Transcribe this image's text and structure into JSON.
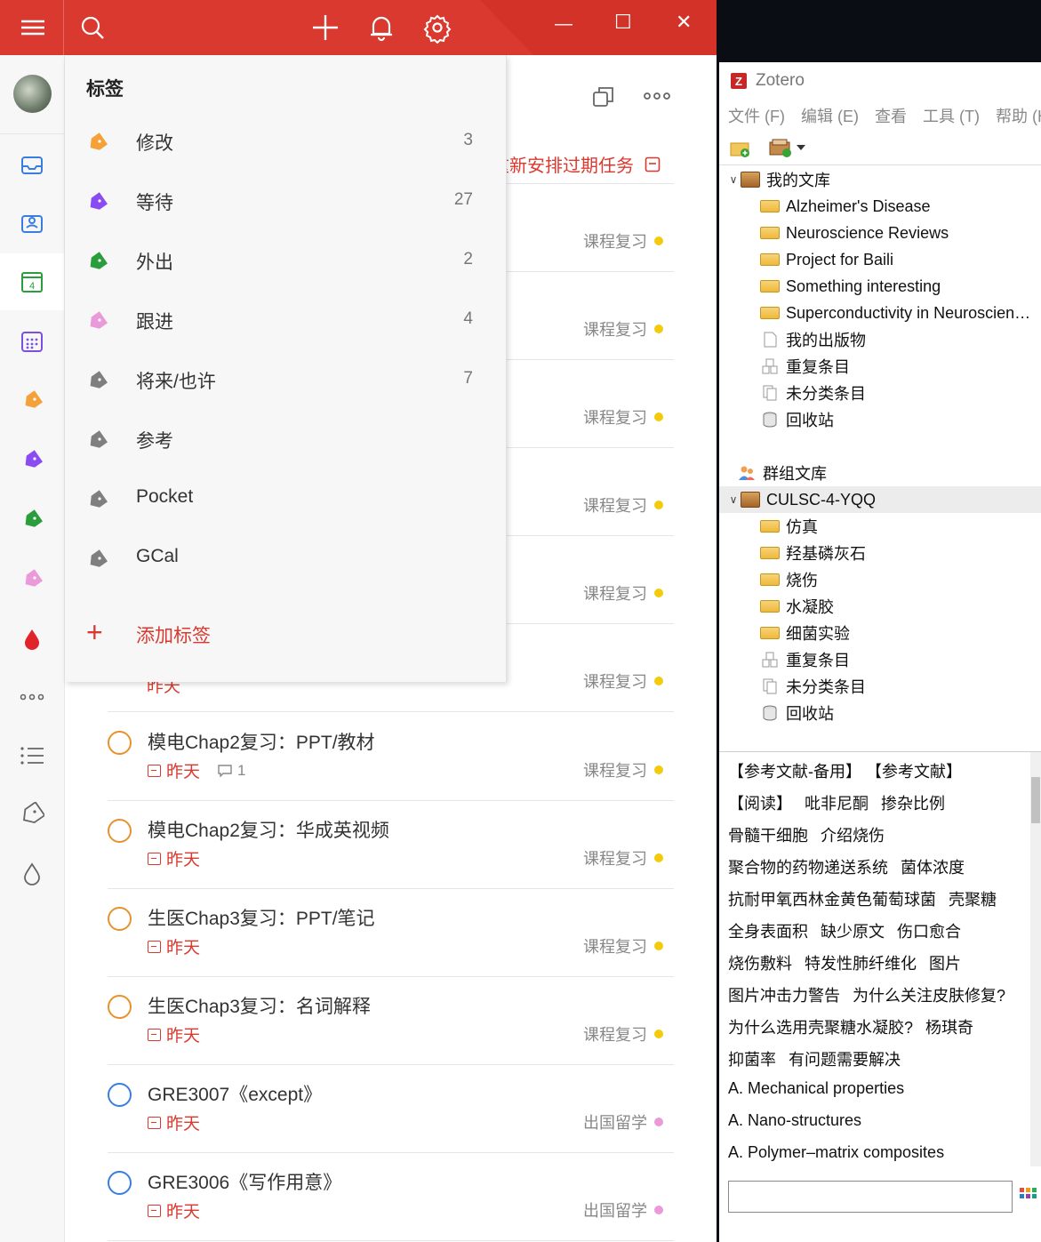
{
  "dida": {
    "window_controls": {
      "minimize": "—",
      "maximize": "☐",
      "close": "✕"
    },
    "toolbar": {
      "reschedule_label": "重新安排过期任务"
    },
    "tags_menu": {
      "header": "标签",
      "items": [
        {
          "name": "修改",
          "count": "3",
          "color": "#f5a13a"
        },
        {
          "name": "等待",
          "count": "27",
          "color": "#8a4cf2"
        },
        {
          "name": "外出",
          "count": "2",
          "color": "#2a9d3c"
        },
        {
          "name": "跟进",
          "count": "4",
          "color": "#ea9ad9"
        },
        {
          "name": "将来/也许",
          "count": "7",
          "color": "#7f7f7f"
        },
        {
          "name": "参考",
          "count": "",
          "color": "#7f7f7f"
        },
        {
          "name": "Pocket",
          "count": "",
          "color": "#7f7f7f"
        },
        {
          "name": "GCal",
          "count": "",
          "color": "#7f7f7f"
        }
      ],
      "add_label": "添加标签"
    },
    "hidden_lists": [
      "课程复习",
      "课程复习",
      "课程复习",
      "课程复习",
      "课程复习",
      "课程复习"
    ],
    "partial_date": "昨天",
    "tasks": [
      {
        "title": "模电Chap2复习：PPT/教材",
        "date": "昨天",
        "comment": "1",
        "list": "课程复习",
        "list_color": "#f2cc0c",
        "circle": "orange"
      },
      {
        "title": "模电Chap2复习：华成英视频",
        "date": "昨天",
        "comment": "",
        "list": "课程复习",
        "list_color": "#f2cc0c",
        "circle": "orange"
      },
      {
        "title": "生医Chap3复习：PPT/笔记",
        "date": "昨天",
        "comment": "",
        "list": "课程复习",
        "list_color": "#f2cc0c",
        "circle": "orange"
      },
      {
        "title": "生医Chap3复习：名词解释",
        "date": "昨天",
        "comment": "",
        "list": "课程复习",
        "list_color": "#f2cc0c",
        "circle": "orange"
      },
      {
        "title": "GRE3007《except》",
        "date": "昨天",
        "comment": "",
        "list": "出国留学",
        "list_color": "#ea9ad9",
        "circle": "blue"
      },
      {
        "title": "GRE3006《写作用意》",
        "date": "昨天",
        "comment": "",
        "list": "出国留学",
        "list_color": "#ea9ad9",
        "circle": "blue"
      }
    ],
    "accent": "#d9392f"
  },
  "zotero": {
    "title": "Zotero",
    "menu": [
      "文件 (F)",
      "编辑 (E)",
      "查看",
      "工具 (T)",
      "帮助 (H"
    ],
    "my_library": {
      "label": "我的文库",
      "items": [
        {
          "label": "Alzheimer's Disease",
          "icon": "folder"
        },
        {
          "label": "Neuroscience Reviews",
          "icon": "folder"
        },
        {
          "label": "Project for Baili",
          "icon": "folder"
        },
        {
          "label": "Something interesting",
          "icon": "folder"
        },
        {
          "label": "Superconductivity in Neuroscien…",
          "icon": "folder"
        },
        {
          "label": "我的出版物",
          "icon": "doc"
        },
        {
          "label": "重复条目",
          "icon": "dup"
        },
        {
          "label": "未分类条目",
          "icon": "unfiled"
        },
        {
          "label": "回收站",
          "icon": "trash"
        }
      ]
    },
    "group_libraries_label": "群组文库",
    "group": {
      "label": "CULSC-4-YQQ",
      "items": [
        {
          "label": "仿真",
          "icon": "folder"
        },
        {
          "label": "羟基磷灰石",
          "icon": "folder"
        },
        {
          "label": "烧伤",
          "icon": "folder"
        },
        {
          "label": "水凝胶",
          "icon": "folder"
        },
        {
          "label": "细菌实验",
          "icon": "folder"
        },
        {
          "label": "重复条目",
          "icon": "dup"
        },
        {
          "label": "未分类条目",
          "icon": "unfiled"
        },
        {
          "label": "回收站",
          "icon": "trash"
        }
      ]
    },
    "tag_rows": [
      [
        "【参考文献-备用】",
        "【参考文献】"
      ],
      [
        "【阅读】",
        "吡非尼酮",
        "掺杂比例"
      ],
      [
        "骨髓干细胞",
        "介绍烧伤"
      ],
      [
        "聚合物的药物递送系统",
        "菌体浓度"
      ],
      [
        "抗耐甲氧西林金黄色葡萄球菌",
        "壳聚糖"
      ],
      [
        "全身表面积",
        "缺少原文",
        "伤口愈合"
      ],
      [
        "烧伤敷料",
        "特发性肺纤维化",
        "图片"
      ],
      [
        "图片冲击力警告",
        "为什么关注皮肤修复?"
      ],
      [
        "为什么选用壳聚糖水凝胶?",
        "杨琪奇"
      ],
      [
        "抑菌率",
        "有问题需要解决"
      ],
      [
        "A. Mechanical properties"
      ],
      [
        "A. Nano-structures"
      ],
      [
        "A. Polymer–matrix composites"
      ]
    ]
  }
}
